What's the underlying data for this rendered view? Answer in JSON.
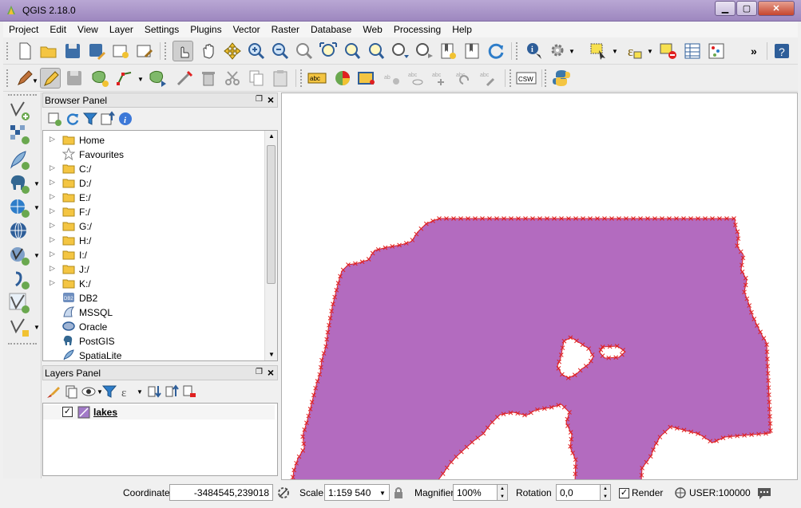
{
  "window": {
    "title": "QGIS 2.18.0"
  },
  "menu": [
    "Project",
    "Edit",
    "View",
    "Layer",
    "Settings",
    "Plugins",
    "Vector",
    "Raster",
    "Database",
    "Web",
    "Processing",
    "Help"
  ],
  "toolbar2_labels": {
    "label_tool": "abc",
    "csw": "CSW"
  },
  "browser_panel": {
    "title": "Browser Panel",
    "items": [
      {
        "label": "Home",
        "icon": "folder-icon",
        "expandable": true
      },
      {
        "label": "Favourites",
        "icon": "star-icon",
        "expandable": false
      },
      {
        "label": "C:/",
        "icon": "folder-icon",
        "expandable": true
      },
      {
        "label": "D:/",
        "icon": "folder-icon",
        "expandable": true
      },
      {
        "label": "E:/",
        "icon": "folder-icon",
        "expandable": true
      },
      {
        "label": "F:/",
        "icon": "folder-icon",
        "expandable": true
      },
      {
        "label": "G:/",
        "icon": "folder-icon",
        "expandable": true
      },
      {
        "label": "H:/",
        "icon": "folder-icon",
        "expandable": true
      },
      {
        "label": "I:/",
        "icon": "folder-icon",
        "expandable": true
      },
      {
        "label": "J:/",
        "icon": "folder-icon",
        "expandable": true
      },
      {
        "label": "K:/",
        "icon": "folder-icon",
        "expandable": true
      },
      {
        "label": "DB2",
        "icon": "db2-icon",
        "expandable": false
      },
      {
        "label": "MSSQL",
        "icon": "mssql-icon",
        "expandable": false
      },
      {
        "label": "Oracle",
        "icon": "oracle-icon",
        "expandable": false
      },
      {
        "label": "PostGIS",
        "icon": "postgis-icon",
        "expandable": false
      },
      {
        "label": "SpatiaLite",
        "icon": "spatialite-icon",
        "expandable": false
      }
    ],
    "db2_badge": "DB2"
  },
  "layers_panel": {
    "title": "Layers Panel",
    "layers": [
      {
        "name": "lakes",
        "visible": true,
        "checked_mark": "✓"
      }
    ]
  },
  "map": {
    "fill_color": "#b36bbf",
    "edge_color": "#e02020"
  },
  "statusbar": {
    "coordinate_label": "Coordinate",
    "coordinate_value": "-3484545,239018",
    "scale_label": "Scale",
    "scale_value": "1:159 540",
    "magnifier_label": "Magnifier",
    "magnifier_value": "100%",
    "rotation_label": "Rotation",
    "rotation_value": "0,0",
    "render_label": "Render",
    "render_checked_mark": "✓",
    "crs_label": "USER:100000"
  }
}
